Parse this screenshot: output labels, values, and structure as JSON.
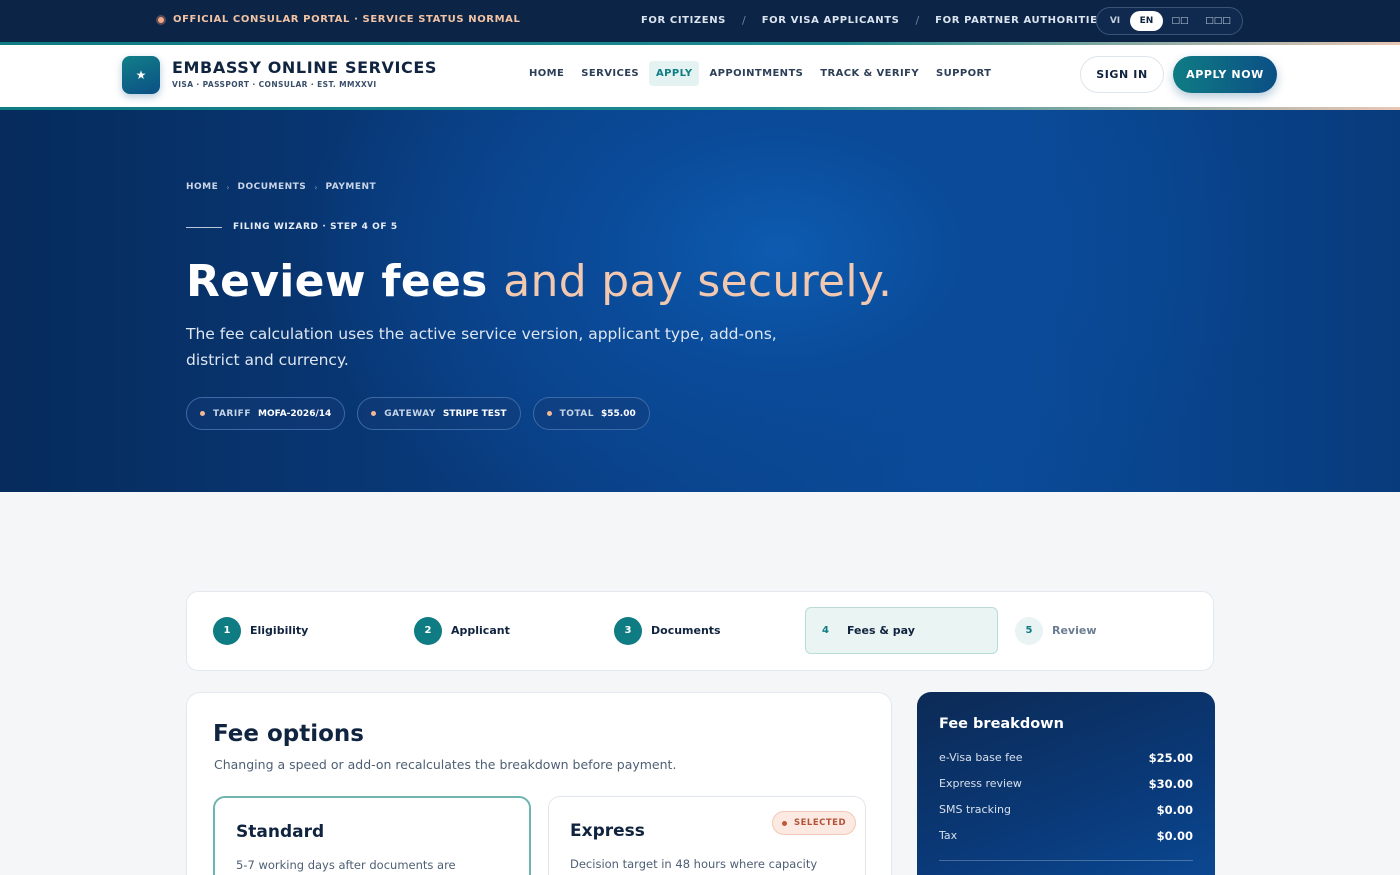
{
  "topbar": {
    "status": "OFFICIAL CONSULAR PORTAL · SERVICE STATUS NORMAL",
    "audiences": [
      "FOR CITIZENS",
      "FOR VISA APPLICANTS",
      "FOR PARTNER AUTHORITIES"
    ],
    "separator": "/",
    "languages": [
      "VI",
      "EN",
      "□□",
      "□□□"
    ],
    "active_language": "EN"
  },
  "header": {
    "logo_glyph": "★",
    "title": "EMBASSY ONLINE SERVICES",
    "subtitle": "VISA · PASSPORT · CONSULAR · EST. MMXXVI",
    "nav": [
      "HOME",
      "SERVICES",
      "APPLY",
      "APPOINTMENTS",
      "TRACK & VERIFY",
      "SUPPORT"
    ],
    "active_nav": "APPLY",
    "sign_in": "SIGN IN",
    "apply_now": "APPLY NOW"
  },
  "hero": {
    "breadcrumb": [
      "HOME",
      "DOCUMENTS",
      "PAYMENT"
    ],
    "breadcrumb_separator": "›",
    "eyebrow": "FILING WIZARD · STEP 4 OF 5",
    "headline_strong": "Review fees",
    "headline_soft": "and pay securely.",
    "lede": "The fee calculation uses the active service version, applicant type, add-ons, district and currency.",
    "chips": [
      {
        "key": "TARIFF",
        "value": "MOFA-2026/14"
      },
      {
        "key": "GATEWAY",
        "value": "STRIPE TEST"
      },
      {
        "key": "TOTAL",
        "value": "$55.00"
      }
    ]
  },
  "stepper": {
    "steps": [
      {
        "num": "1",
        "label": "Eligibility",
        "state": "done"
      },
      {
        "num": "2",
        "label": "Applicant",
        "state": "done"
      },
      {
        "num": "3",
        "label": "Documents",
        "state": "done"
      },
      {
        "num": "4",
        "label": "Fees & pay",
        "state": "current"
      },
      {
        "num": "5",
        "label": "Review",
        "state": "todo"
      }
    ]
  },
  "fee_options": {
    "title": "Fee options",
    "subtitle": "Changing a speed or add-on recalculates the breakdown before payment.",
    "options": [
      {
        "title": "Standard",
        "description": "5-7 working days after documents are"
      },
      {
        "title": "Express",
        "description": "Decision target in 48 hours where capacity",
        "badge": "SELECTED"
      }
    ]
  },
  "breakdown": {
    "title": "Fee breakdown",
    "rows": [
      {
        "label": "e-Visa base fee",
        "value": "$25.00"
      },
      {
        "label": "Express review",
        "value": "$30.00"
      },
      {
        "label": "SMS tracking",
        "value": "$0.00"
      },
      {
        "label": "Tax",
        "value": "$0.00"
      }
    ]
  },
  "colors": {
    "navy": "#0c2547",
    "teal": "#0f7c84",
    "peach": "#f2c9b0",
    "hero_blue": "#0a4a98"
  }
}
